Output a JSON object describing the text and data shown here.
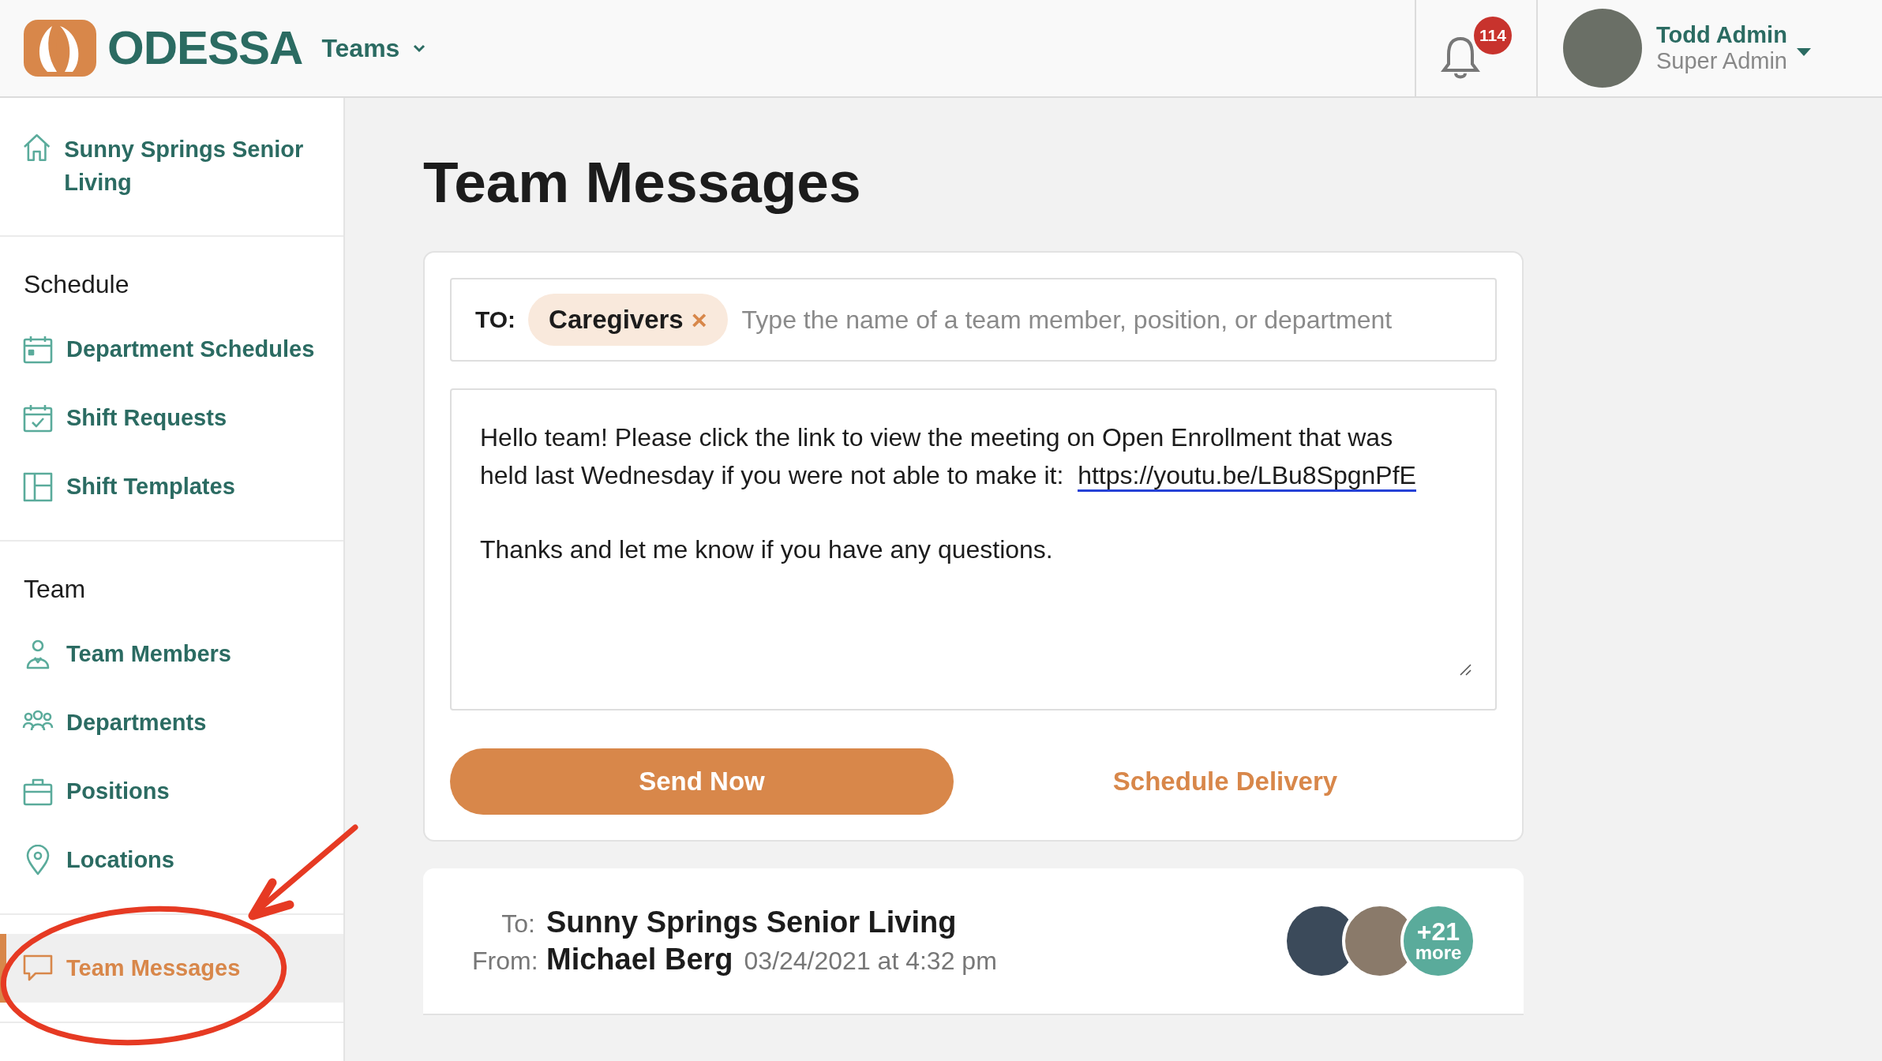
{
  "header": {
    "logo": "ODESSA",
    "team_menu": "Teams",
    "notifications": {
      "count": "114"
    },
    "user": {
      "name": "Todd Admin",
      "role": "Super Admin"
    }
  },
  "sidebar": {
    "org": "Sunny Springs Senior Living",
    "sections": [
      {
        "heading": "Schedule",
        "items": [
          {
            "label": "Department Schedules",
            "selected": false
          },
          {
            "label": "Shift Requests",
            "selected": false
          },
          {
            "label": "Shift Templates",
            "selected": false
          }
        ]
      },
      {
        "heading": "Team",
        "items": [
          {
            "label": "Team Members",
            "selected": false
          },
          {
            "label": "Departments",
            "selected": false
          },
          {
            "label": "Positions",
            "selected": false
          },
          {
            "label": "Locations",
            "selected": false
          }
        ]
      },
      {
        "items": [
          {
            "label": "Team Messages",
            "selected": true
          }
        ]
      }
    ]
  },
  "page": {
    "title": "Team Messages"
  },
  "composer": {
    "to_label": "TO:",
    "recipients": [
      {
        "label": "Caregivers",
        "remove": "×"
      }
    ],
    "placeholder": "Type the name of a team member, position, or department",
    "message": {
      "text": "Hello team!  Please click the link to view the meeting on Open Enrollment that was held last Wednesday if you were not able to make it:",
      "link": "https://youtu.be/LBu8SpgnPfE",
      "closing": "Thanks and let me know if you have any questions."
    },
    "send_button": "Send Now",
    "schedule_button": "Schedule Delivery"
  },
  "messages": [
    {
      "to_label": "To:",
      "to": "Sunny Springs Senior Living",
      "from_label": "From:",
      "from": "Michael Berg",
      "date": "03/24/2021 at 4:32 pm",
      "more_count": "+21",
      "more_label": "more"
    }
  ]
}
